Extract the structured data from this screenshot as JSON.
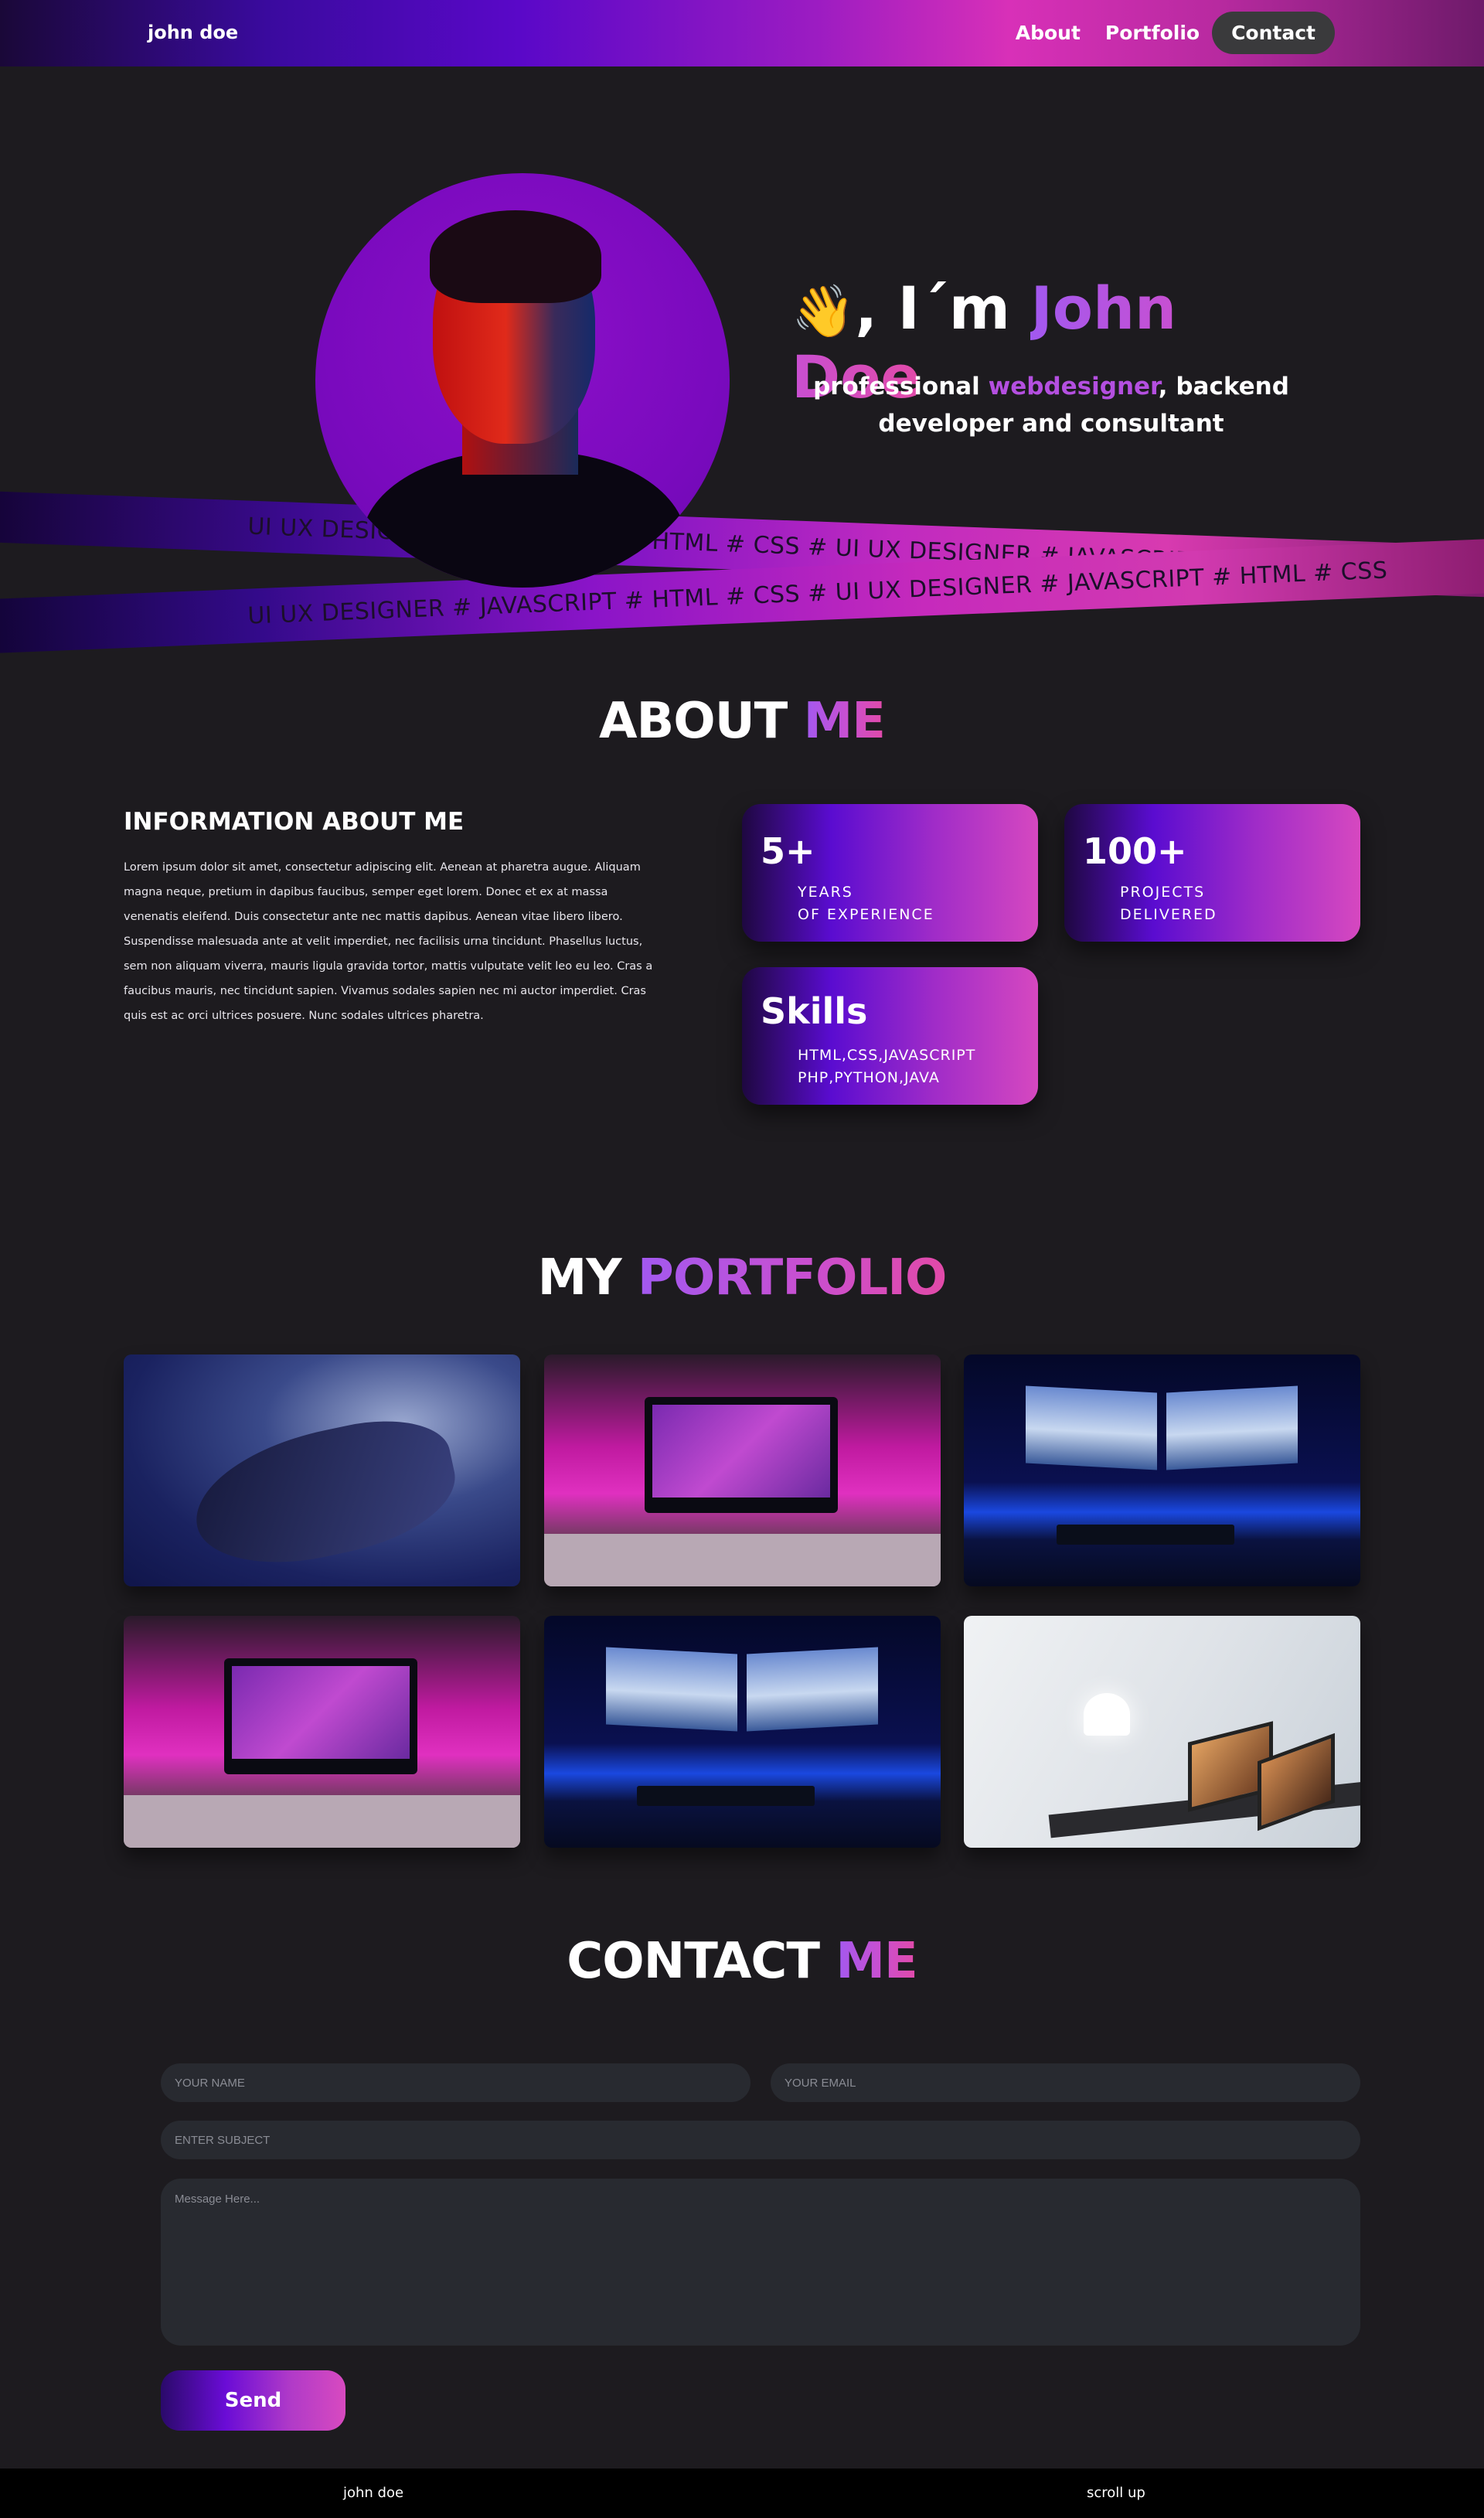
{
  "nav": {
    "brand": "john doe",
    "links": [
      "About",
      "Portfolio",
      "Contact"
    ]
  },
  "hero": {
    "wave_emoji": "👋",
    "greeting": ", I´m ",
    "name": "John Doe",
    "subtitle_pre": "professional ",
    "subtitle_highlight": "webdesigner",
    "subtitle_post": ", backend developer and consultant",
    "ribbon_1_text": "UI UX DESIGNER # JAVASCRIPT # HTML # CSS # UI UX DESIGNER # JAVASCRIPT # HTML # CSS",
    "ribbon_2_text": "UI UX DESIGNER # JAVASCRIPT # HTML # CSS # UI UX DESIGNER # JAVASCRIPT # HTML # CSS"
  },
  "about": {
    "title_1": "ABOUT ",
    "title_2": "ME",
    "info_heading": "INFORMATION ABOUT ME",
    "info_text": "Lorem ipsum dolor sit amet, consectetur adipiscing elit. Aenean at pharetra augue. Aliquam magna neque, pretium in dapibus faucibus, semper eget lorem. Donec et ex at massa venenatis eleifend. Duis consectetur ante nec mattis dapibus. Aenean vitae libero libero. Suspendisse malesuada ante at velit imperdiet, nec facilisis urna tincidunt. Phasellus luctus, sem non aliquam viverra, mauris ligula gravida tortor, mattis vulputate velit leo eu leo. Cras a faucibus mauris, nec tincidunt sapien. Vivamus sodales sapien nec mi auctor imperdiet. Cras quis est ac orci ultrices posuere. Nunc sodales ultrices pharetra.",
    "cards": [
      {
        "num": "5+",
        "line1": "YEARS",
        "line2": "OF EXPERIENCE"
      },
      {
        "num": "100+",
        "line1": "PROJECTS",
        "line2": "DELIVERED"
      },
      {
        "num": "Skills",
        "line1": "HTML,CSS,JAVASCRIPT",
        "line2": "PHP,PYTHON,JAVA"
      }
    ]
  },
  "portfolio": {
    "title_1": "MY ",
    "title_2": "PORTFOLIO"
  },
  "contact": {
    "title_1": "CONTACT ",
    "title_2": "ME",
    "name_placeholder": "YOUR NAME",
    "email_placeholder": "YOUR EMAIL",
    "subject_placeholder": "ENTER SUBJECT",
    "message_placeholder": "Message Here...",
    "send_label": "Send"
  },
  "footer": {
    "brand": "john doe",
    "scroll_up": "scroll up"
  },
  "colors": {
    "background": "#1d1b1f",
    "accent_purple": "#a259f0",
    "accent_pink": "#e24aa8",
    "field_bg": "#282a30"
  }
}
